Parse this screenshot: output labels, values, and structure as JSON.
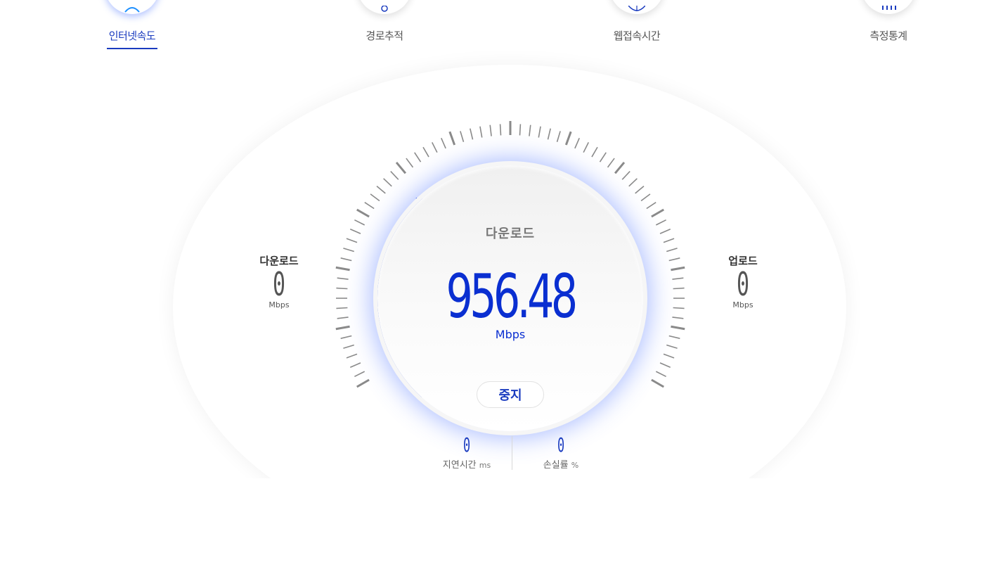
{
  "tabs": [
    {
      "label": "인터넷속도",
      "active": true,
      "icon": "speedometer-icon"
    },
    {
      "label": "경로추적",
      "active": false,
      "icon": "route-icon"
    },
    {
      "label": "웹접속시간",
      "active": false,
      "icon": "globe-icon"
    },
    {
      "label": "측정통계",
      "active": false,
      "icon": "stats-icon"
    }
  ],
  "gauge": {
    "mode_label": "다운로드",
    "value": "956.48",
    "unit": "Mbps",
    "stop_label": "중지",
    "progress": 0.32,
    "accent_color": "#0a2fd1",
    "tick_color": "#8a8a8a"
  },
  "download": {
    "title": "다운로드",
    "value": "0",
    "unit": "Mbps"
  },
  "upload": {
    "title": "업로드",
    "value": "0",
    "unit": "Mbps"
  },
  "latency": {
    "value": "0",
    "label": "지연시간",
    "unit": "ms"
  },
  "loss": {
    "value": "0",
    "label": "손실률",
    "unit": "%"
  }
}
